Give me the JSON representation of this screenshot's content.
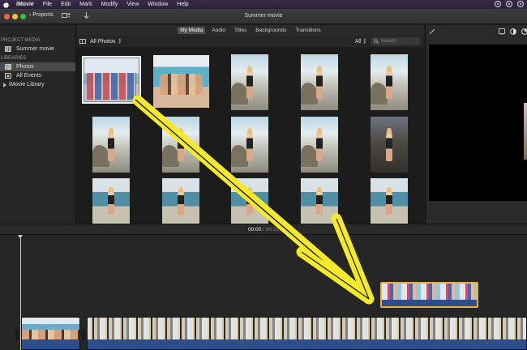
{
  "menubar": {
    "items": [
      "iMovie",
      "File",
      "Edit",
      "Mark",
      "Modify",
      "View",
      "Window",
      "Help"
    ]
  },
  "toolbar": {
    "projects_label": "Projects",
    "window_title": "Summer movie"
  },
  "sidebar": {
    "project_media_heading": "PROJECT MEDIA",
    "project_item": "Summer movie",
    "libraries_heading": "LIBRARIES",
    "library_items": [
      "Photos",
      "All Events",
      "iMovie Library"
    ]
  },
  "browser": {
    "tabs": [
      "My Media",
      "Audio",
      "Titles",
      "Backgrounds",
      "Transitions"
    ],
    "active_tab": "My Media",
    "source_label": "All Photos",
    "filter_label": "All",
    "search_placeholder": "Search"
  },
  "timeline": {
    "current_time": "00:00",
    "separator": "/",
    "duration": "00:22"
  },
  "colors": {
    "selection_outline": "#f3f3f3",
    "drag_clip_border": "#e6b43a",
    "annotation_arrow": "#f5ea2a"
  }
}
